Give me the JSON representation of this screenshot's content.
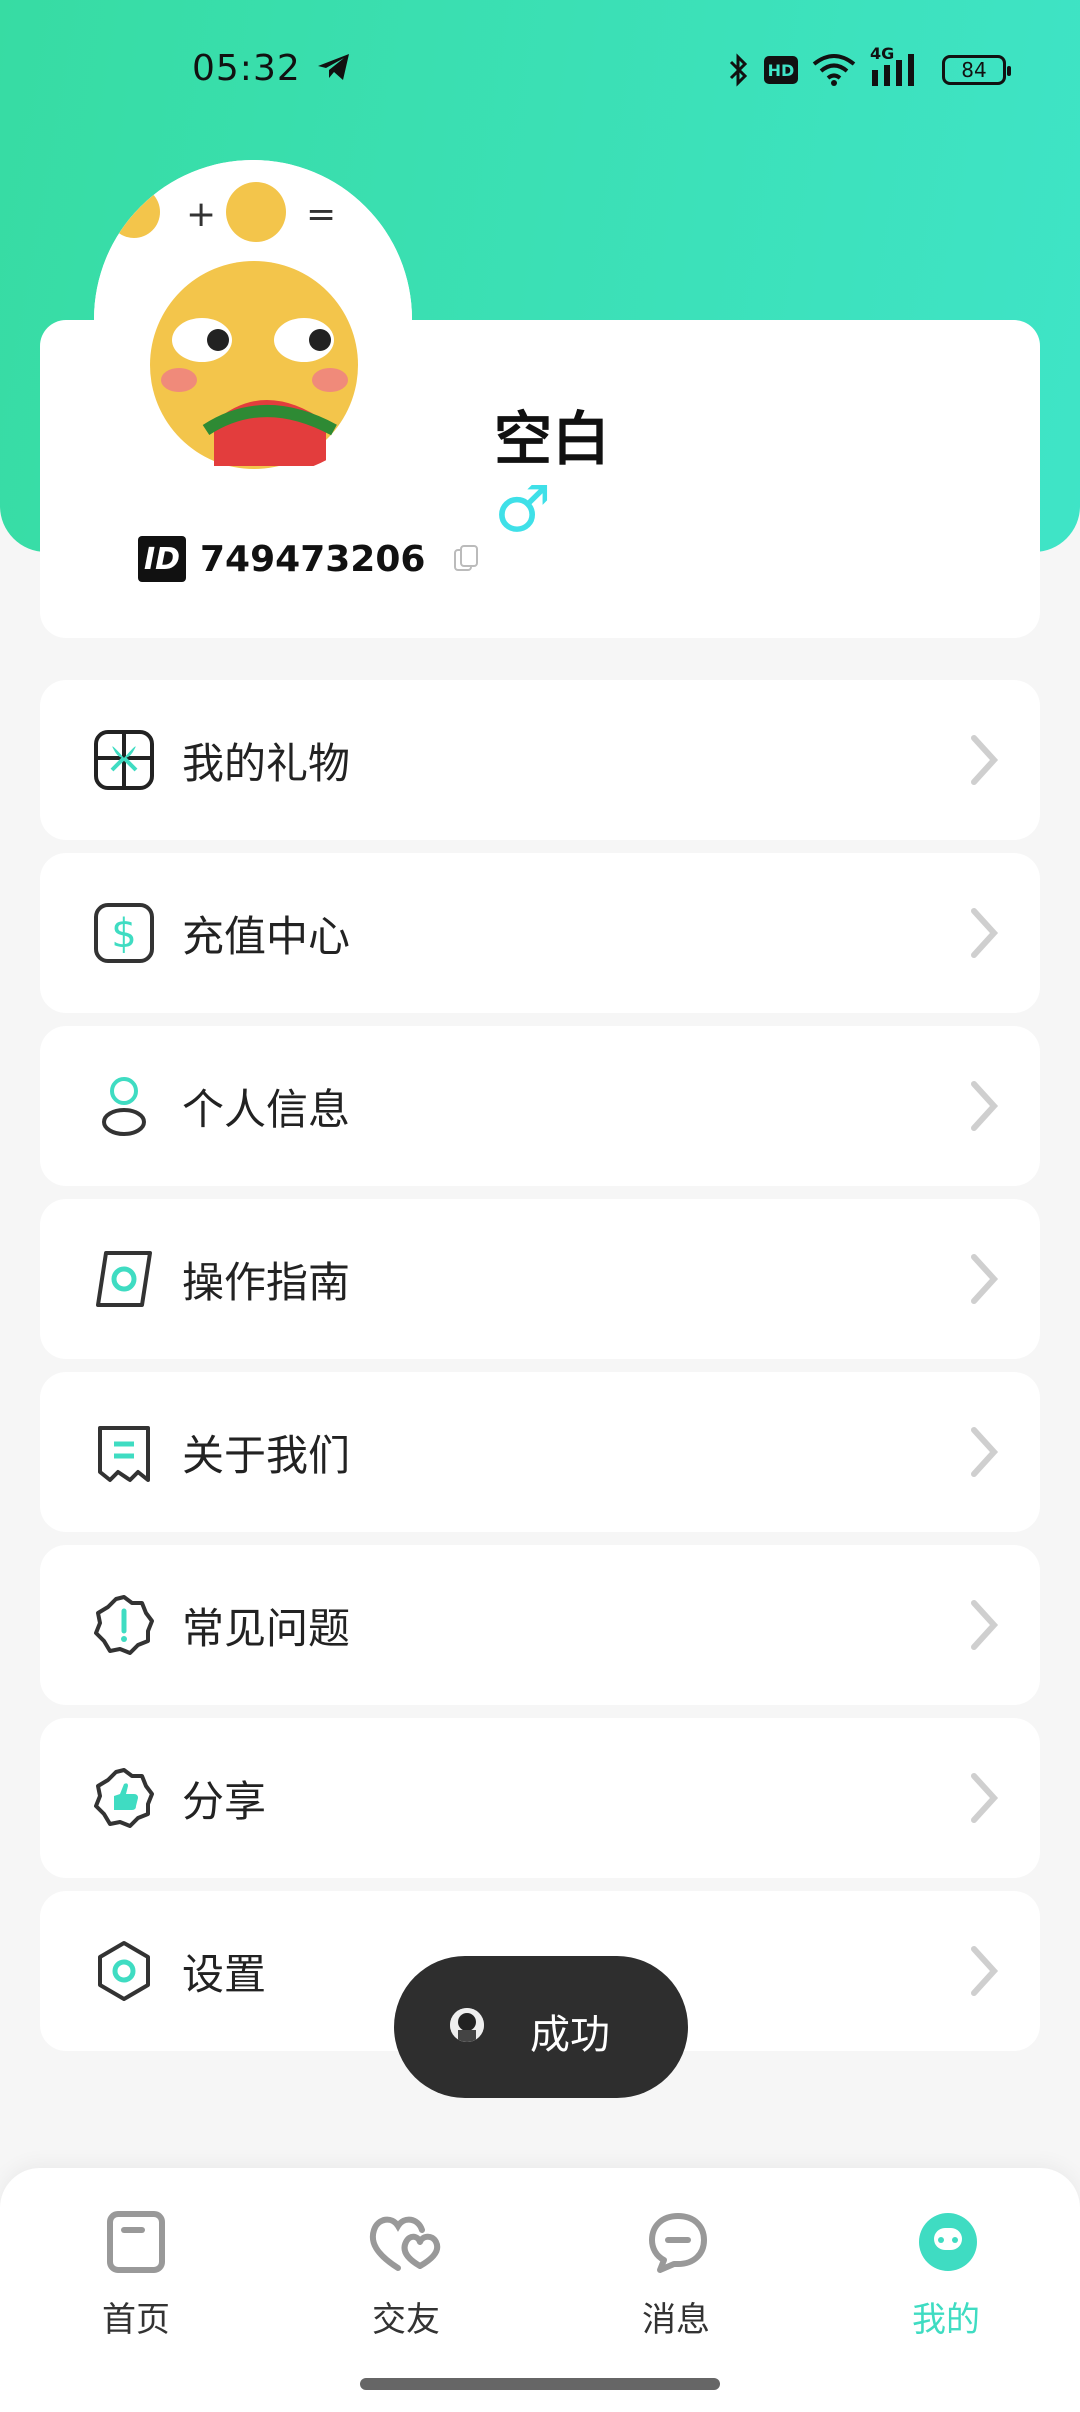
{
  "status_bar": {
    "time": "05:32",
    "hd": "HD",
    "network": "4G",
    "battery": "84"
  },
  "profile": {
    "nickname": "空白",
    "gender": "♂",
    "id_label": "ID",
    "id_number": "749473206"
  },
  "menu": [
    {
      "label": "我的礼物",
      "icon": "gift-icon"
    },
    {
      "label": "充值中心",
      "icon": "recharge-icon"
    },
    {
      "label": "个人信息",
      "icon": "person-icon"
    },
    {
      "label": "操作指南",
      "icon": "guide-icon"
    },
    {
      "label": "关于我们",
      "icon": "about-icon"
    },
    {
      "label": "常见问题",
      "icon": "faq-icon"
    },
    {
      "label": "分享",
      "icon": "share-icon"
    },
    {
      "label": "设置",
      "icon": "settings-icon"
    }
  ],
  "toast": {
    "text": "成功"
  },
  "tabs": [
    {
      "label": "首页",
      "icon": "home-icon"
    },
    {
      "label": "交友",
      "icon": "hearts-icon"
    },
    {
      "label": "消息",
      "icon": "message-icon"
    },
    {
      "label": "我的",
      "icon": "profile-face-icon"
    }
  ],
  "colors": {
    "accent": "#3fdcc2",
    "hero_start": "#37dca3",
    "hero_end": "#3fe4c7",
    "gender": "#3fe0e8"
  }
}
